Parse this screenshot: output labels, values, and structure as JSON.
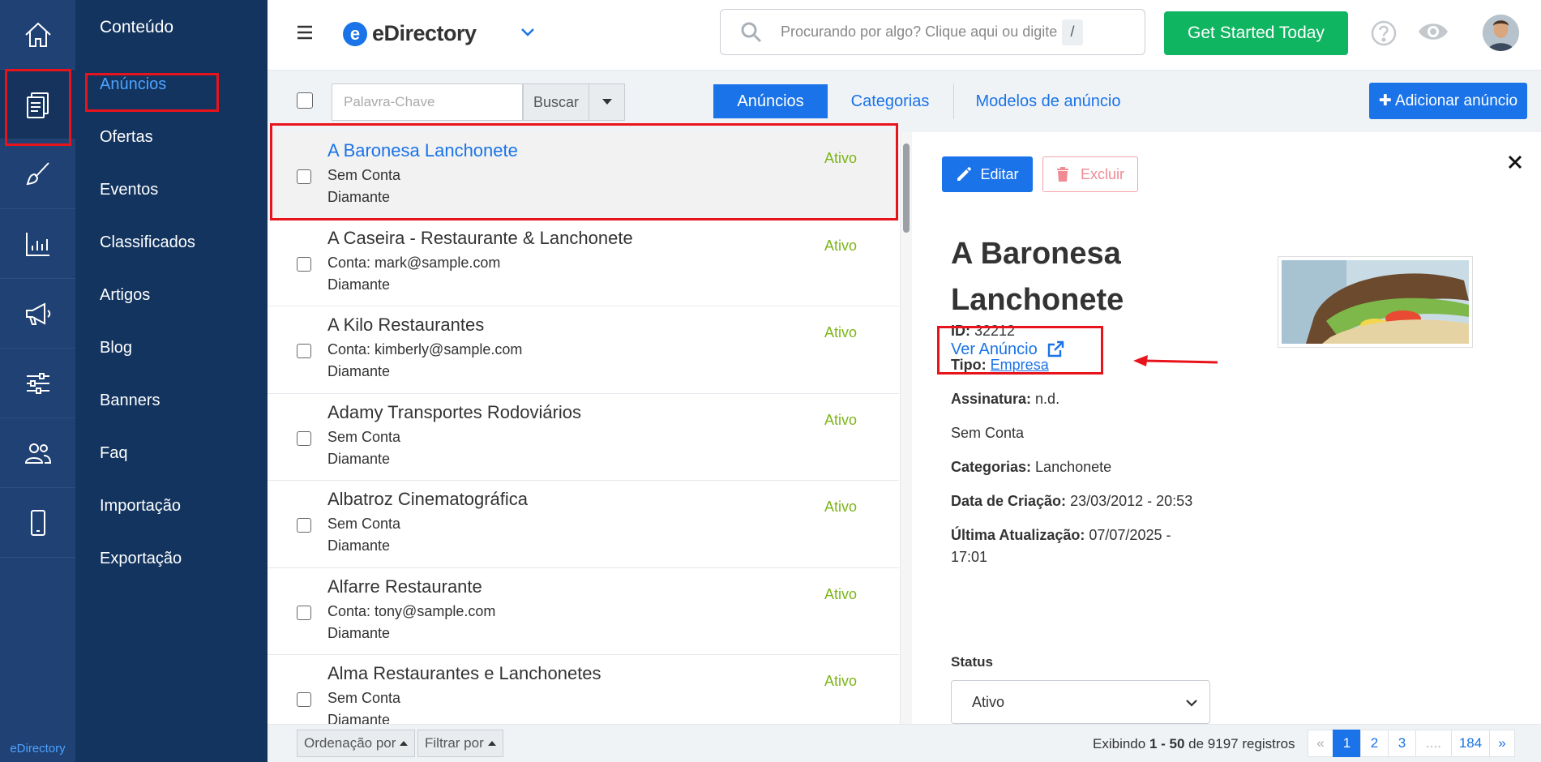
{
  "rail": {
    "items": [
      "home-icon",
      "content-icon",
      "brush-icon",
      "chart-icon",
      "megaphone-icon",
      "sliders-icon",
      "users-icon",
      "mobile-icon"
    ],
    "footer": "eDirectory"
  },
  "submenu": {
    "title": "Conteúdo",
    "items": [
      "Anúncios",
      "Ofertas",
      "Eventos",
      "Classificados",
      "Artigos",
      "Blog",
      "Banners",
      "Faq",
      "Importação",
      "Exportação"
    ]
  },
  "header": {
    "logo_letter": "e",
    "logo_text": "eDirectory",
    "search_placeholder": "Procurando por algo? Clique aqui ou digite",
    "search_key": "/",
    "cta": "Get Started Today"
  },
  "toolbar": {
    "keyword_placeholder": "Palavra-Chave",
    "search_button": "Buscar",
    "tabs": [
      "Anúncios",
      "Categorias",
      "Modelos de anúncio"
    ],
    "add_button": "✚ Adicionar anúncio"
  },
  "listings": [
    {
      "title": "A Baronesa Lanchonete",
      "account": "Sem Conta",
      "plan": "Diamante",
      "status": "Ativo"
    },
    {
      "title": "A Caseira - Restaurante & Lanchonete",
      "account": "Conta: mark@sample.com",
      "plan": "Diamante",
      "status": "Ativo"
    },
    {
      "title": "A Kilo Restaurantes",
      "account": "Conta: kimberly@sample.com",
      "plan": "Diamante",
      "status": "Ativo"
    },
    {
      "title": "Adamy Transportes Rodoviários",
      "account": "Sem Conta",
      "plan": "Diamante",
      "status": "Ativo"
    },
    {
      "title": "Albatroz Cinematográfica",
      "account": "Sem Conta",
      "plan": "Diamante",
      "status": "Ativo"
    },
    {
      "title": "Alfarre Restaurante",
      "account": "Conta: tony@sample.com",
      "plan": "Diamante",
      "status": "Ativo"
    },
    {
      "title": "Alma Restaurantes e Lanchonetes",
      "account": "Sem Conta",
      "plan": "Diamante",
      "status": "Ativo"
    }
  ],
  "detail": {
    "edit_button": "Editar",
    "delete_button": "Excluir",
    "title": "A Baronesa Lanchonete",
    "view_link": "Ver Anúncio",
    "id_label": "ID:",
    "id_value": "32212",
    "type_label": "Tipo:",
    "type_value": "Empresa",
    "subscription_label": "Assinatura:",
    "subscription_value": "n.d.",
    "account": "Sem Conta",
    "categories_label": "Categorias:",
    "categories_value": "Lanchonete",
    "created_label": "Data de Criação:",
    "created_value": "23/03/2012 - 20:53",
    "updated_label": "Última Atualização:",
    "updated_value": "07/07/2025 - 17:01",
    "status_label": "Status",
    "status_value": "Ativo"
  },
  "footer": {
    "sort_button": "Ordenação por",
    "filter_button": "Filtrar por",
    "records_prefix": "Exibindo ",
    "records_range": "1 - 50",
    "records_mid": " de ",
    "records_total": "9197",
    "records_suffix": " registros",
    "pages": [
      "«",
      "1",
      "2",
      "3",
      "....",
      "184",
      "»"
    ]
  },
  "colors": {
    "rail": "#1f4173",
    "submenu": "#12345f",
    "primary": "#1a73e8",
    "cta": "#10b561",
    "status_active": "#7cb518",
    "annotation": "#e8141c"
  }
}
